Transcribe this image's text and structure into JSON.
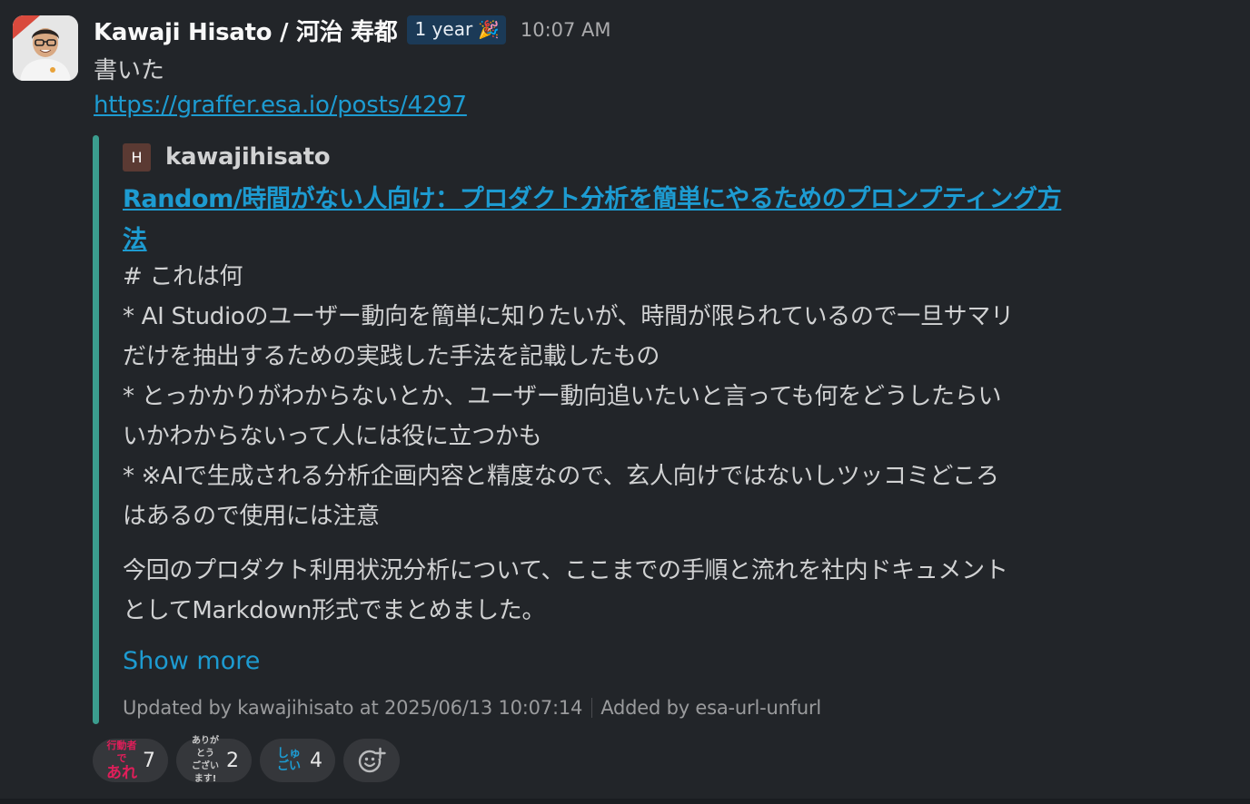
{
  "message": {
    "author": "Kawaji Hisato / 河治 寿都",
    "badge": "1 year",
    "badge_emoji": "🎉",
    "time": "10:07 AM",
    "text": "書いた",
    "link": "https://graffer.esa.io/posts/4297"
  },
  "unfurl": {
    "site_icon_letter": "H",
    "site_name": "kawajihisato",
    "title_line1": "Random/時間がない人向け：プロダクト分析を簡単にやるためのプロンプティング方",
    "title_line2": "法",
    "body_lines": [
      "# これは何",
      "* AI Studioのユーザー動向を簡単に知りたいが、時間が限られているので一旦サマリ",
      "だけを抽出するための実践した手法を記載したもの",
      "* とっかかりがわからないとか、ユーザー動向追いたいと言っても何をどうしたらい",
      "いかわからないって人には役に立つかも",
      "* ※AIで生成される分析企画内容と精度なので、玄人向けではないしツッコミどころ",
      "はあるので使用には注意"
    ],
    "para2_lines": [
      "今回のプロダクト利用状況分析について、ここまでの手順と流れを社内ドキュメント",
      "としてMarkdown形式でまとめました。"
    ],
    "show_more": "Show more",
    "footer_updated": "Updated by kawajihisato at 2025/06/13 10:07:14",
    "footer_added": "Added by esa-url-unfurl"
  },
  "reactions": [
    {
      "emoji_name": "行動者であれ",
      "line1": "行動者で",
      "line2": "あれ",
      "count": "7",
      "color1": "#e01e5a",
      "color2": "#e01e5a"
    },
    {
      "emoji_name": "ありがとうございます",
      "line1": "ありがとう",
      "line2": "ございます!",
      "count": "2",
      "color1": "#c9c9c9",
      "color2": "#c9c9c9"
    },
    {
      "emoji_name": "しゅごい",
      "line1": "しゅごい",
      "line2": "",
      "count": "4",
      "color1": "#1d9bd1",
      "color2": "#1d9bd1"
    }
  ],
  "icons": {
    "avatar": "user-avatar",
    "add_reaction": "add-reaction-icon"
  }
}
